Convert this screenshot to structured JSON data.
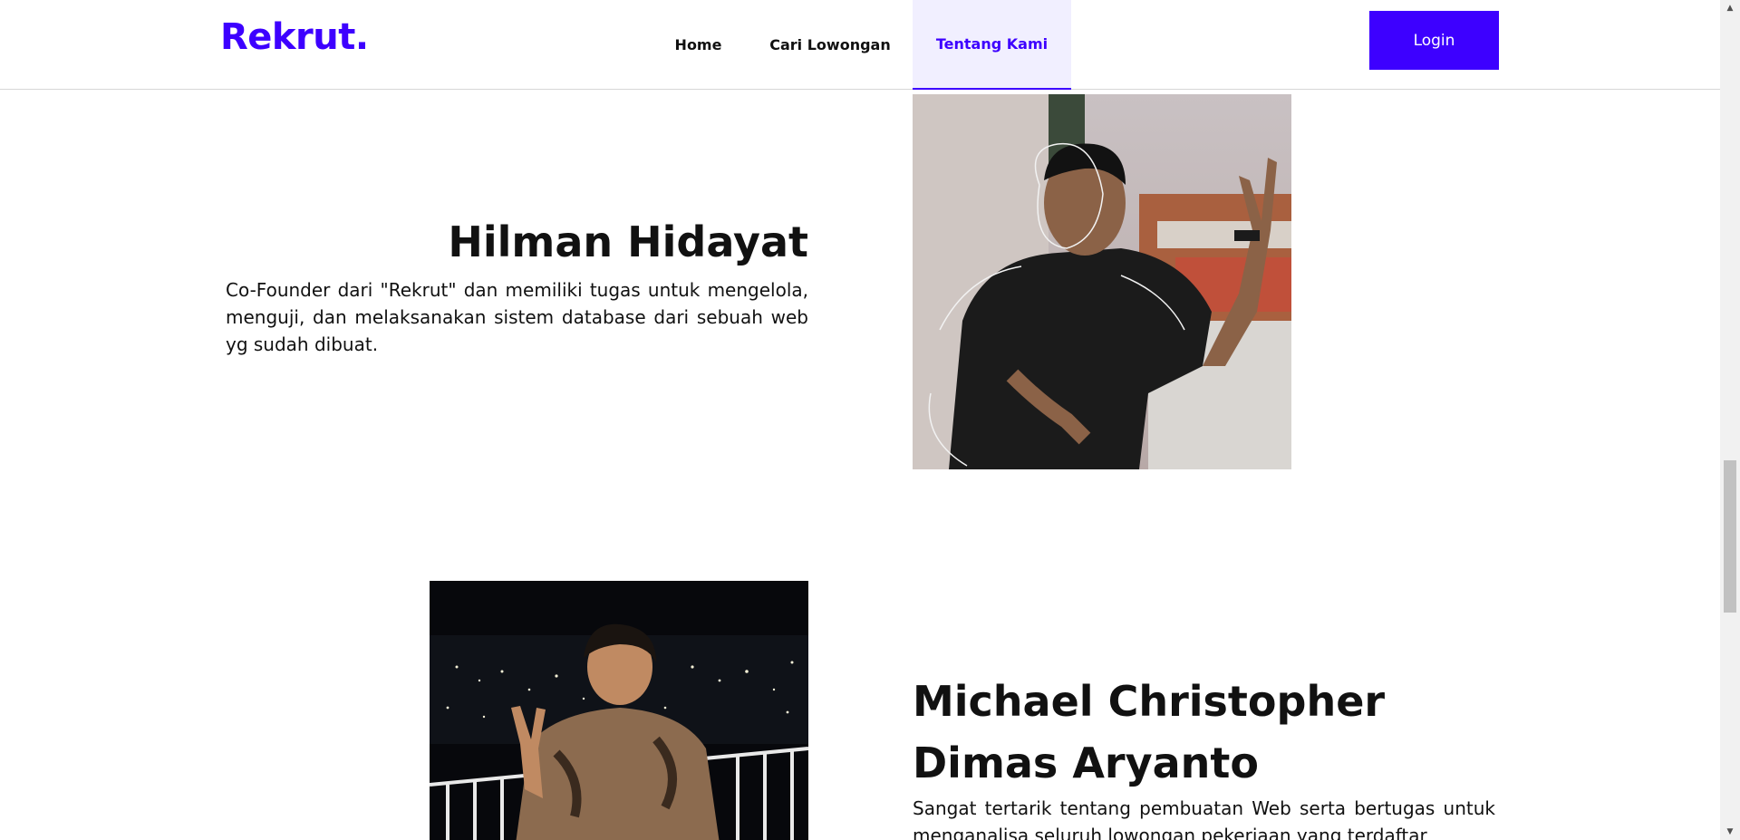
{
  "navbar": {
    "logo": "Rekrut.",
    "links": [
      {
        "label": "Home"
      },
      {
        "label": "Cari Lowongan"
      },
      {
        "label": "Tentang Kami",
        "active": true
      }
    ],
    "login_label": "Login"
  },
  "members": [
    {
      "name": "Hilman Hidayat",
      "description": "Co-Founder dari \"Rekrut\" dan memiliki tugas untuk mengelola, menguji, dan melaksanakan sistem database dari sebuah web yg sudah dibuat.",
      "photo_icon": "person-photo"
    },
    {
      "name": "Michael Christopher Dimas Aryanto",
      "description": "Sangat tertarik tentang pembuatan Web serta bertugas untuk menganalisa seluruh lowongan pekerjaan yang terdaftar",
      "photo_icon": "person-photo"
    }
  ],
  "colors": {
    "brand": "#3d00ff",
    "active_tab_bg": "#f1efff",
    "text": "#111111"
  }
}
